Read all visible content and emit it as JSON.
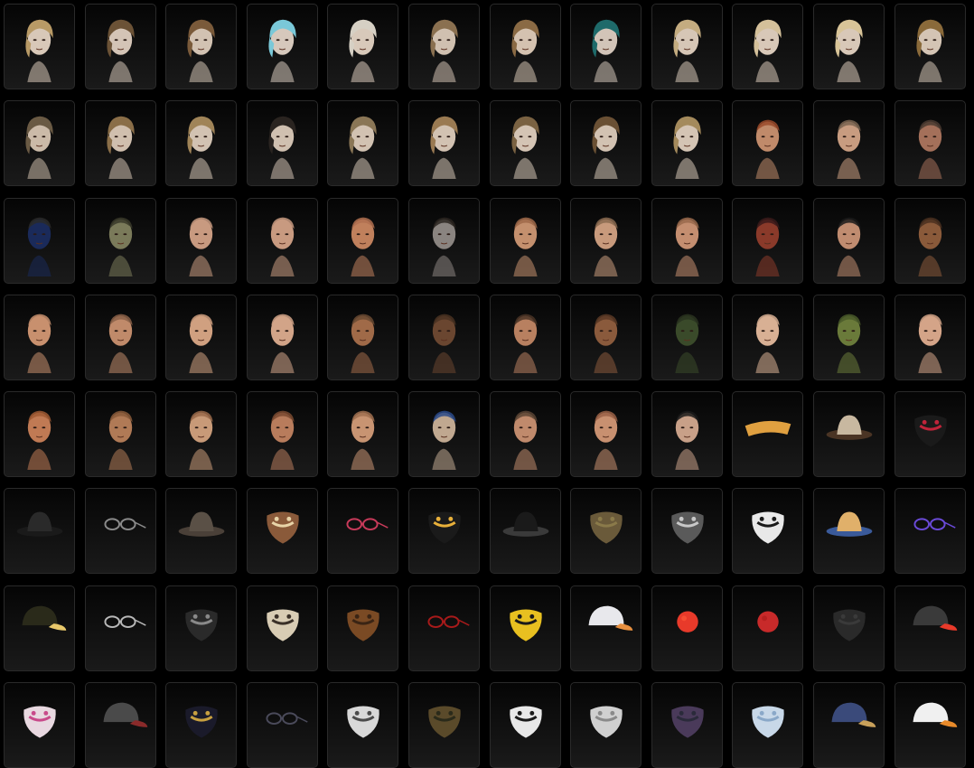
{
  "inventory": {
    "items": [
      {
        "icon": "short-blonde-hair-icon",
        "skin": "#d8c8b8",
        "color": "#b89a66"
      },
      {
        "icon": "brown-undercut-hair-icon",
        "skin": "#d4c4b6",
        "color": "#6b5236"
      },
      {
        "icon": "ponytail-hair-icon",
        "skin": "#d2c2b2",
        "color": "#7a5a3a"
      },
      {
        "icon": "pink-blue-bob-hair-icon",
        "skin": "#d6c8bc",
        "color": "#7ac8d8"
      },
      {
        "icon": "spiky-white-hair-icon",
        "skin": "#d8c9ba",
        "color": "#d6d0c4"
      },
      {
        "icon": "dreadlocks-hair-icon",
        "skin": "#d0c0b0",
        "color": "#8a7050"
      },
      {
        "icon": "bubble-braid-hair-icon",
        "skin": "#d4c2b0",
        "color": "#8a6a44"
      },
      {
        "icon": "teal-bob-hair-icon",
        "skin": "#d2c4b8",
        "color": "#1e6a6a"
      },
      {
        "icon": "blonde-bob-hair-icon",
        "skin": "#d6c6b6",
        "color": "#c4ac80"
      },
      {
        "icon": "platinum-bob-hair-icon",
        "skin": "#d8c8b8",
        "color": "#d4c09a"
      },
      {
        "icon": "blonde-swept-hair-icon",
        "skin": "#d8c8b8",
        "color": "#d8c498"
      },
      {
        "icon": "leopard-buzz-hair-icon",
        "skin": "#d4c4b4",
        "color": "#8a6a3a"
      },
      {
        "icon": "long-wavy-hair-icon",
        "skin": "#cbbaa8",
        "color": "#6a5a44"
      },
      {
        "icon": "side-braid-hair-icon",
        "skin": "#d0bfae",
        "color": "#8a6e48"
      },
      {
        "icon": "two-tone-bob-hair-icon",
        "skin": "#d2c2b2",
        "color": "#a08458"
      },
      {
        "icon": "dark-undercut-hair-icon",
        "skin": "#d0c0b0",
        "color": "#2a2420"
      },
      {
        "icon": "messy-short-hair-icon",
        "skin": "#d2c2b2",
        "color": "#8a7656"
      },
      {
        "icon": "long-braid-hair-icon",
        "skin": "#d2c2b2",
        "color": "#9a7a52"
      },
      {
        "icon": "textured-crop-hair-icon",
        "skin": "#d4c4b4",
        "color": "#7a6242"
      },
      {
        "icon": "side-part-hair-icon",
        "skin": "#d2c2b2",
        "color": "#6a5034"
      },
      {
        "icon": "blonde-fringe-hair-icon",
        "skin": "#d4c4b4",
        "color": "#a48a5c"
      },
      {
        "icon": "auburn-face-icon",
        "skin": "#c08a6a",
        "color": "#9a4a2a"
      },
      {
        "icon": "male-short-face-icon",
        "skin": "#c89c80",
        "color": "#7a6450"
      },
      {
        "icon": "scarred-face-icon",
        "skin": "#a4705a",
        "color": "#4a3a30"
      },
      {
        "icon": "blue-paint-face-icon",
        "skin": "#1a2a5a",
        "color": "#2a2a2a"
      },
      {
        "icon": "camo-paint-face-icon",
        "skin": "#7a7a5a",
        "color": "#3a3a2a"
      },
      {
        "icon": "tattoo-face-icon",
        "skin": "#c89a80",
        "color": "#c89a80"
      },
      {
        "icon": "tribal-tattoo-face-icon",
        "skin": "#c89a80",
        "color": "#c89a80"
      },
      {
        "icon": "bald-female-face-icon",
        "skin": "#c0805c",
        "color": "#b07050"
      },
      {
        "icon": "skull-paint-face-icon",
        "skin": "#8a8480",
        "color": "#2a2420"
      },
      {
        "icon": "female-face-icon",
        "skin": "#c4906e",
        "color": "#a06a4a"
      },
      {
        "icon": "dark-eyes-face-icon",
        "skin": "#c89a7c",
        "color": "#8a6a50"
      },
      {
        "icon": "female-natural-face-icon",
        "skin": "#c48e70",
        "color": "#9a6a4c"
      },
      {
        "icon": "red-paint-face-icon",
        "skin": "#8a3a2a",
        "color": "#3a1a1a"
      },
      {
        "icon": "black-paint-face-icon",
        "skin": "#c08c70",
        "color": "#1a1a1a"
      },
      {
        "icon": "dark-male-face-icon",
        "skin": "#8a5a3a",
        "color": "#4a3020"
      },
      {
        "icon": "bald-male-face-icon",
        "skin": "#c8906e",
        "color": "#c8906e"
      },
      {
        "icon": "buzz-male-face-icon",
        "skin": "#c08a6a",
        "color": "#8a6048"
      },
      {
        "icon": "bald-light-face-icon",
        "skin": "#d0a080",
        "color": "#d0a080"
      },
      {
        "icon": "bald-pale-face-icon",
        "skin": "#d2a488",
        "color": "#d2a488"
      },
      {
        "icon": "tan-male-face-icon",
        "skin": "#a06a48",
        "color": "#6a4a32"
      },
      {
        "icon": "dark-female-face-icon",
        "skin": "#6a4630",
        "color": "#4a3222"
      },
      {
        "icon": "bearded-male-face-icon",
        "skin": "#b88060",
        "color": "#4a3426"
      },
      {
        "icon": "brown-male-face-icon",
        "skin": "#8a5a3c",
        "color": "#5a3a26"
      },
      {
        "icon": "green-camo-face-icon",
        "skin": "#3a4a2a",
        "color": "#2a3420"
      },
      {
        "icon": "pale-bald-face-icon",
        "skin": "#d8b094",
        "color": "#d8b094"
      },
      {
        "icon": "green-paint-face-icon",
        "skin": "#6a7a3a",
        "color": "#4a5a2a"
      },
      {
        "icon": "bald-smooth-face-icon",
        "skin": "#d4a488",
        "color": "#d4a488"
      },
      {
        "icon": "redhead-buzz-face-icon",
        "skin": "#c07a54",
        "color": "#a05a34"
      },
      {
        "icon": "tan-female-face-icon",
        "skin": "#b07a56",
        "color": "#8a5a3a"
      },
      {
        "icon": "asian-female-face-icon",
        "skin": "#c89a78",
        "color": "#9a6a4a"
      },
      {
        "icon": "brunette-face-icon",
        "skin": "#b87c5c",
        "color": "#7a4a30"
      },
      {
        "icon": "freckled-face-icon",
        "skin": "#c89472",
        "color": "#a07050"
      },
      {
        "icon": "blue-white-paint-face-icon",
        "skin": "#c0a890",
        "color": "#2a4a8a"
      },
      {
        "icon": "stubble-male-face-icon",
        "skin": "#c08a6c",
        "color": "#5a4434"
      },
      {
        "icon": "soft-female-face-icon",
        "skin": "#c89070",
        "color": "#9a6246"
      },
      {
        "icon": "eye-stripes-face-icon",
        "skin": "#c8a088",
        "color": "#1a1a1a"
      },
      {
        "icon": "gold-visor-icon",
        "skin": "#c08a3a",
        "color": "#e0a040"
      },
      {
        "icon": "beanie-wig-icon",
        "skin": "#c8b8a0",
        "color": "#4a3424"
      },
      {
        "icon": "mouth-mask-icon",
        "skin": "#1a1a1a",
        "color": "#c0243a"
      },
      {
        "icon": "witch-hat-icon",
        "skin": "#2a2a2a",
        "color": "#1a1a1a"
      },
      {
        "icon": "round-sunglasses-icon",
        "skin": "#3a3a3a",
        "color": "#8a8a8a"
      },
      {
        "icon": "bucket-hat-icon",
        "skin": "#5a5046",
        "color": "#4a4038"
      },
      {
        "icon": "bunny-mask-icon",
        "skin": "#8a5a3a",
        "color": "#e8d4a8"
      },
      {
        "icon": "heart-glasses-icon",
        "skin": "#e8e8e8",
        "color": "#c83a5a"
      },
      {
        "icon": "cat-eye-mask-icon",
        "skin": "#1a1a1a",
        "color": "#e8b03a"
      },
      {
        "icon": "cat-ear-beanie-icon",
        "skin": "#1a1a1a",
        "color": "#3a3a3a"
      },
      {
        "icon": "camo-headwrap-icon",
        "skin": "#6a5a3a",
        "color": "#8a7a4a"
      },
      {
        "icon": "gas-mask-helmet-icon",
        "skin": "#5a5a5a",
        "color": "#c8c8c8"
      },
      {
        "icon": "zebra-mask-icon",
        "skin": "#e8e8e8",
        "color": "#1a1a1a"
      },
      {
        "icon": "straw-hat-icon",
        "skin": "#e0b06a",
        "color": "#3a5a9a"
      },
      {
        "icon": "pink-heart-glasses-icon",
        "skin": "#c84aa8",
        "color": "#6a4ad8"
      },
      {
        "icon": "headset-cap-icon",
        "skin": "#2a2a1a",
        "color": "#e8c86a"
      },
      {
        "icon": "aviator-sunglasses-icon",
        "skin": "#1a1a1a",
        "color": "#b8b8b8"
      },
      {
        "icon": "spiked-muzzle-icon",
        "skin": "#2a2a2a",
        "color": "#8a8a8a"
      },
      {
        "icon": "skull-mask-icon",
        "skin": "#d8ccb4",
        "color": "#3a3028"
      },
      {
        "icon": "bear-mask-icon",
        "skin": "#7a4a24",
        "color": "#3a2414"
      },
      {
        "icon": "red-glasses-icon",
        "skin": "#c82a2a",
        "color": "#a81a1a"
      },
      {
        "icon": "yellow-gas-mask-icon",
        "skin": "#e8c020",
        "color": "#1a1a1a"
      },
      {
        "icon": "white-cap-icon",
        "skin": "#e8e8ec",
        "color": "#e89040"
      },
      {
        "icon": "red-clown-nose-icon",
        "skin": "#e83a2a",
        "color": "#ff5a3a"
      },
      {
        "icon": "red-ball-nose-icon",
        "skin": "#c82a2a",
        "color": "#a81a1a"
      },
      {
        "icon": "black-cloth-mask-icon",
        "skin": "#2a2a2a",
        "color": "#3a3a3a"
      },
      {
        "icon": "black-cap-icon",
        "skin": "#3a3a3a",
        "color": "#e83a2a"
      },
      {
        "icon": "pink-graffiti-mask-icon",
        "skin": "#e8d8e0",
        "color": "#c84a8a"
      },
      {
        "icon": "dark-cap-icon",
        "skin": "#4a4a4a",
        "color": "#8a2a2a"
      },
      {
        "icon": "gold-crown-mask-icon",
        "skin": "#1a1a2a",
        "color": "#c8a040"
      },
      {
        "icon": "tactical-glasses-icon",
        "skin": "#1a1a1a",
        "color": "#4a4a5a"
      },
      {
        "icon": "white-face-shield-icon",
        "skin": "#d8d8d8",
        "color": "#4a4a4a"
      },
      {
        "icon": "camo-bandana-icon",
        "skin": "#5a4a2a",
        "color": "#2a2a1a"
      },
      {
        "icon": "panda-headband-icon",
        "skin": "#e8e8e8",
        "color": "#1a1a1a"
      },
      {
        "icon": "white-surgical-mask-icon",
        "skin": "#d0d0d0",
        "color": "#8a8a8a"
      },
      {
        "icon": "purple-bandana-icon",
        "skin": "#4a3a5a",
        "color": "#2a2a3a"
      },
      {
        "icon": "white-bandana-icon",
        "skin": "#c8d8e8",
        "color": "#8aa8c8"
      },
      {
        "icon": "headset-blue-cap-icon",
        "skin": "#3a4a7a",
        "color": "#c8a05a"
      },
      {
        "icon": "orange-white-cap-icon",
        "skin": "#f0f0f0",
        "color": "#e88a2a"
      }
    ]
  }
}
